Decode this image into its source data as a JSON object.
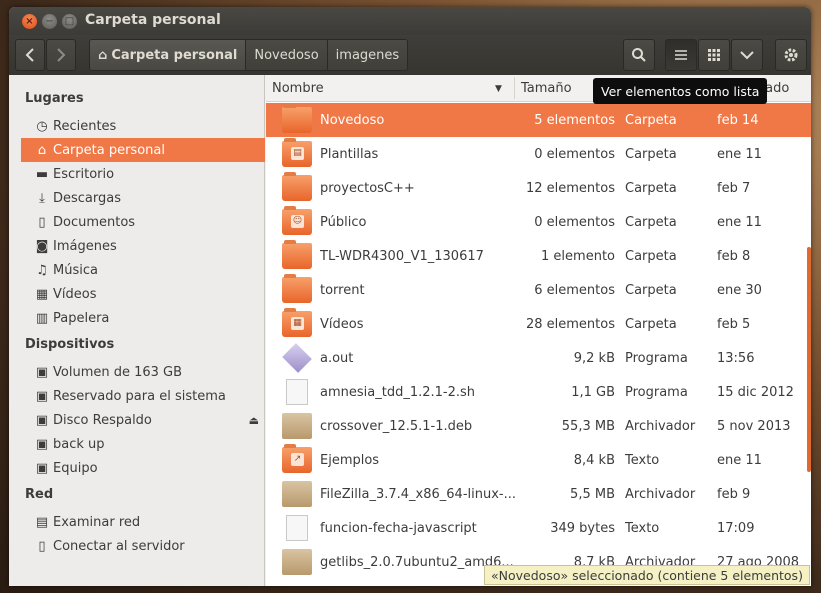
{
  "window": {
    "title": "Carpeta personal"
  },
  "toolbar": {
    "back_icon": "chevron-left-icon",
    "forward_icon": "chevron-right-icon",
    "breadcrumbs": [
      {
        "label": "Carpeta personal",
        "active": true
      },
      {
        "label": "Novedoso",
        "active": false
      },
      {
        "label": "imagenes",
        "active": false
      }
    ],
    "search_icon": "search-icon",
    "list_view_icon": "list-icon",
    "grid_view_icon": "grid-icon",
    "menu_icon": "chevron-down-icon",
    "settings_icon": "gear-icon"
  },
  "tooltip": "Ver elementos como lista",
  "sidebar": {
    "sections": [
      {
        "title": "Lugares"
      },
      {
        "title": "Dispositivos"
      },
      {
        "title": "Red"
      }
    ],
    "places": [
      {
        "label": "Recientes",
        "icon": "clock-icon",
        "glyph": "◷"
      },
      {
        "label": "Carpeta personal",
        "icon": "home-icon",
        "glyph": "⌂"
      },
      {
        "label": "Escritorio",
        "icon": "desktop-icon",
        "glyph": "▬"
      },
      {
        "label": "Descargas",
        "icon": "download-icon",
        "glyph": "⤓"
      },
      {
        "label": "Documentos",
        "icon": "document-icon",
        "glyph": "▯"
      },
      {
        "label": "Imágenes",
        "icon": "camera-icon",
        "glyph": "◙"
      },
      {
        "label": "Música",
        "icon": "music-icon",
        "glyph": "♫"
      },
      {
        "label": "Vídeos",
        "icon": "film-icon",
        "glyph": "▦"
      },
      {
        "label": "Papelera",
        "icon": "trash-icon",
        "glyph": "▥"
      }
    ],
    "devices": [
      {
        "label": "Volumen de 163 GB",
        "icon": "drive-icon",
        "glyph": "▣"
      },
      {
        "label": "Reservado para el sistema",
        "icon": "drive-icon",
        "glyph": "▣"
      },
      {
        "label": "Disco Respaldo",
        "icon": "drive-icon",
        "glyph": "▣",
        "eject": "⏏"
      },
      {
        "label": "back up",
        "icon": "drive-icon",
        "glyph": "▣"
      },
      {
        "label": "Equipo",
        "icon": "drive-icon",
        "glyph": "▣"
      }
    ],
    "network": [
      {
        "label": "Examinar red",
        "icon": "network-icon",
        "glyph": "▤"
      },
      {
        "label": "Conectar al servidor",
        "icon": "server-icon",
        "glyph": "▯"
      }
    ]
  },
  "columns": {
    "name": "Nombre",
    "size": "Tamaño",
    "modified": "cado",
    "sort_icon": "sort-down-icon"
  },
  "files": [
    {
      "name": "Novedoso",
      "size": "5 elementos",
      "type": "Carpeta",
      "date": "feb 14",
      "icon": "folder-icon",
      "selected": true
    },
    {
      "name": "Plantillas",
      "size": "0 elementos",
      "type": "Carpeta",
      "date": "ene 11",
      "icon": "templates-folder-icon"
    },
    {
      "name": "proyectosC++",
      "size": "12 elementos",
      "type": "Carpeta",
      "date": "feb 7",
      "icon": "folder-icon"
    },
    {
      "name": "Público",
      "size": "0 elementos",
      "type": "Carpeta",
      "date": "ene 11",
      "icon": "public-folder-icon"
    },
    {
      "name": "TL-WDR4300_V1_130617",
      "size": "1 elemento",
      "type": "Carpeta",
      "date": "feb 8",
      "icon": "folder-icon"
    },
    {
      "name": "torrent",
      "size": "6 elementos",
      "type": "Carpeta",
      "date": "ene 30",
      "icon": "folder-icon"
    },
    {
      "name": "Vídeos",
      "size": "28 elementos",
      "type": "Carpeta",
      "date": "feb 5",
      "icon": "videos-folder-icon"
    },
    {
      "name": "a.out",
      "size": "9,2 kB",
      "type": "Programa",
      "date": "13:56",
      "icon": "executable-icon"
    },
    {
      "name": "amnesia_tdd_1.2.1-2.sh",
      "size": "1,1 GB",
      "type": "Programa",
      "date": "15 dic 2012",
      "icon": "script-icon"
    },
    {
      "name": "crossover_12.5.1-1.deb",
      "size": "55,3 MB",
      "type": "Archivador",
      "date": "5 nov 2013",
      "icon": "package-icon"
    },
    {
      "name": "Ejemplos",
      "size": "8,4 kB",
      "type": "Texto",
      "date": "ene 11",
      "icon": "folder-link-icon"
    },
    {
      "name": "FileZilla_3.7.4_x86_64-linux-...",
      "size": "5,5 MB",
      "type": "Archivador",
      "date": "feb 9",
      "icon": "package-icon"
    },
    {
      "name": "funcion-fecha-javascript",
      "size": "349 bytes",
      "type": "Texto",
      "date": "17:09",
      "icon": "text-file-icon"
    },
    {
      "name": "getlibs_2.0.7ubuntu2_amd6...",
      "size": "8,7 kB",
      "type": "Archivador",
      "date": "27 ago 2008",
      "icon": "package-icon"
    }
  ],
  "status": "«Novedoso» seleccionado  (contiene 5 elementos)",
  "colors": {
    "accent": "#f07746",
    "titlebar": "#3c3b37"
  }
}
